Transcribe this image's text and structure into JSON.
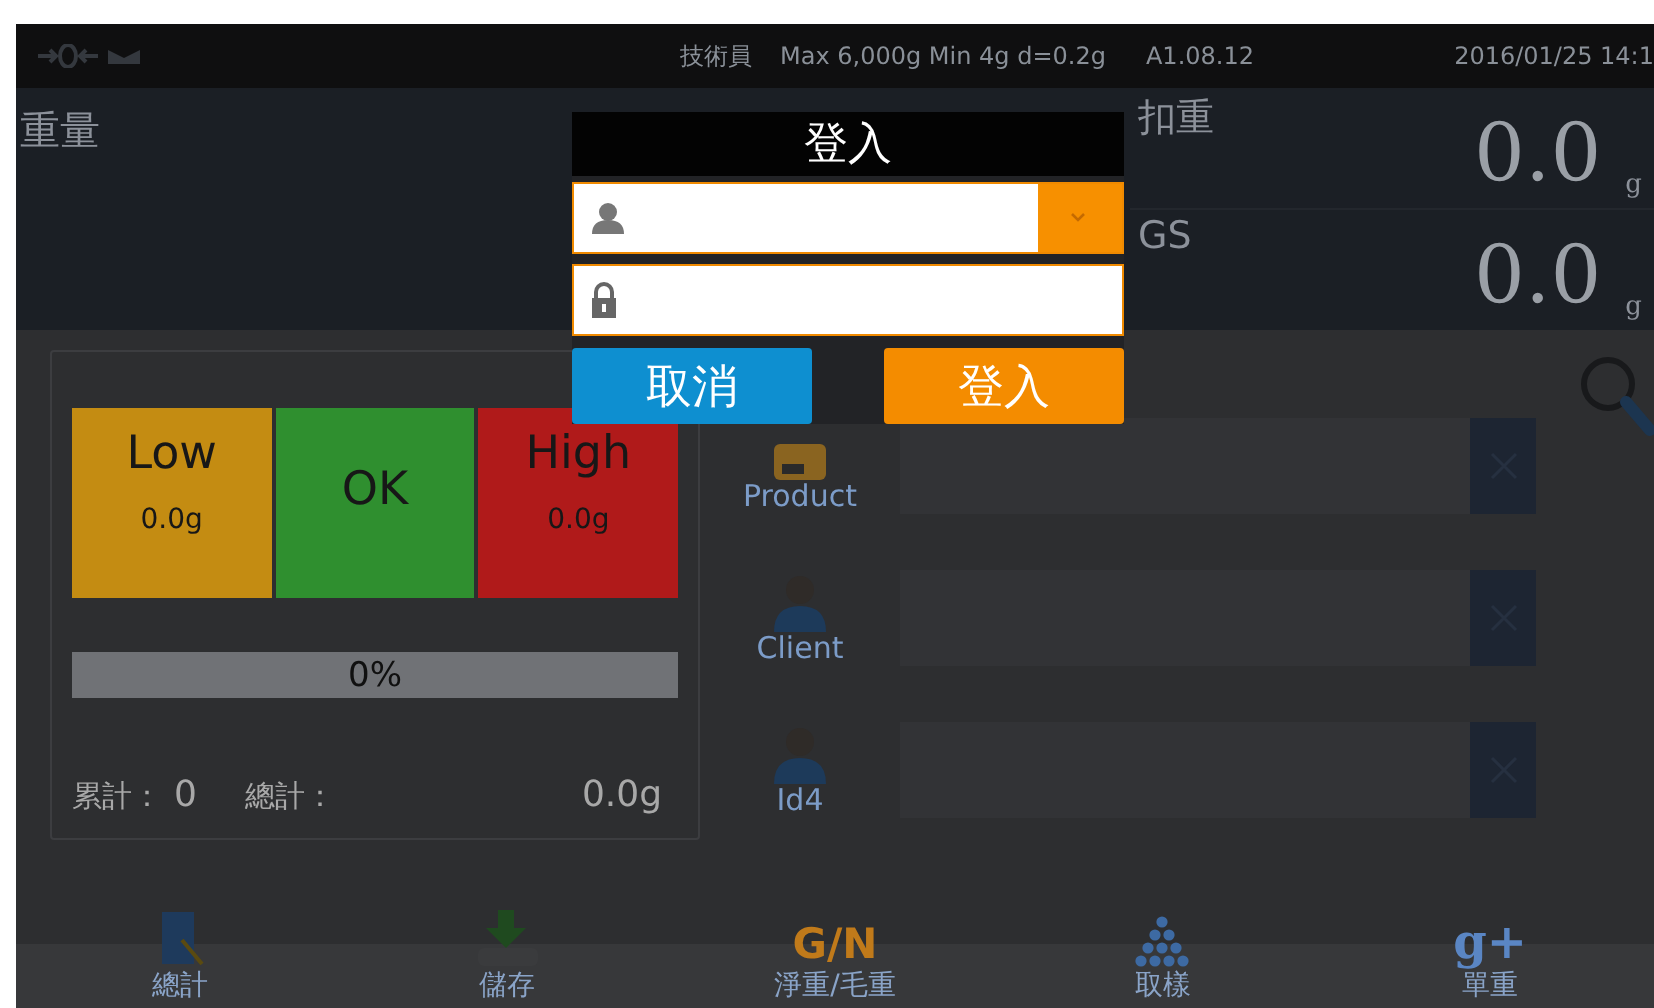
{
  "status_bar": {
    "user": "技術員",
    "spec": "Max 6,000g  Min 4g  d=0.2g",
    "version": "A1.08.12",
    "datetime": "2016/01/25  14:1"
  },
  "weight_panel": {
    "label": "重量"
  },
  "readouts": [
    {
      "label": "扣重",
      "value": "0.0",
      "unit": "g"
    },
    {
      "label": "GS",
      "value": "0.0",
      "unit": "g"
    }
  ],
  "limits": [
    {
      "label": "Low",
      "value": "0.0g",
      "color": "#c48c12"
    },
    {
      "label": "OK",
      "color": "#2f8f2f"
    },
    {
      "label": "High",
      "value": "0.0g",
      "color": "#b01a1a"
    }
  ],
  "progress": {
    "level": 0,
    "reading": "0%"
  },
  "totals": {
    "count_label": "累計：",
    "count": "0",
    "total_label": "總計：",
    "total": "0.0g"
  },
  "fields": [
    {
      "label": "Product",
      "kind": "product"
    },
    {
      "label": "Client",
      "kind": "person"
    },
    {
      "label": "Id4",
      "kind": "person"
    }
  ],
  "toolbar": [
    {
      "label": "總計",
      "kind": "book"
    },
    {
      "label": "儲存",
      "kind": "download"
    },
    {
      "label": "淨重/毛重",
      "kind": "text",
      "icon_text": "G/N"
    },
    {
      "label": "取樣",
      "kind": "dots"
    },
    {
      "label": "單重",
      "kind": "text",
      "icon_text": "g+"
    }
  ],
  "dialog": {
    "title": "登入",
    "cancel": "取消",
    "ok": "登入"
  }
}
